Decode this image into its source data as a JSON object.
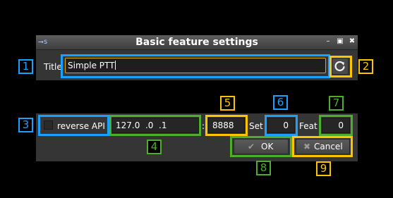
{
  "window": {
    "app_icon": "SDRangel-icon",
    "app_icon_text": "⭢s",
    "title": "Basic feature settings",
    "minimize": "–",
    "maximize": "▣",
    "close": "✖"
  },
  "form": {
    "title_label": "Title",
    "title_value": "Simple PTT",
    "reverse_api_label": "reverse API",
    "reverse_api_checked": false,
    "address_value": "127.0  .0  .1",
    "colon": ":",
    "port_value": "8888",
    "set_label": "Set",
    "set_value": "0",
    "feat_label": "Feat",
    "feat_value": "0"
  },
  "buttons": {
    "ok_label": "OK",
    "ok_icon": "✔",
    "cancel_label": "Cancel",
    "cancel_icon": "✖"
  },
  "annotations": {
    "n1": "1",
    "n2": "2",
    "n3": "3",
    "n4": "4",
    "n5": "5",
    "n6": "6",
    "n7": "7",
    "n8": "8",
    "n9": "9"
  },
  "colors": {
    "blue": "#1aa0ff",
    "yellow": "#ffc400",
    "green": "#4cae2c"
  }
}
